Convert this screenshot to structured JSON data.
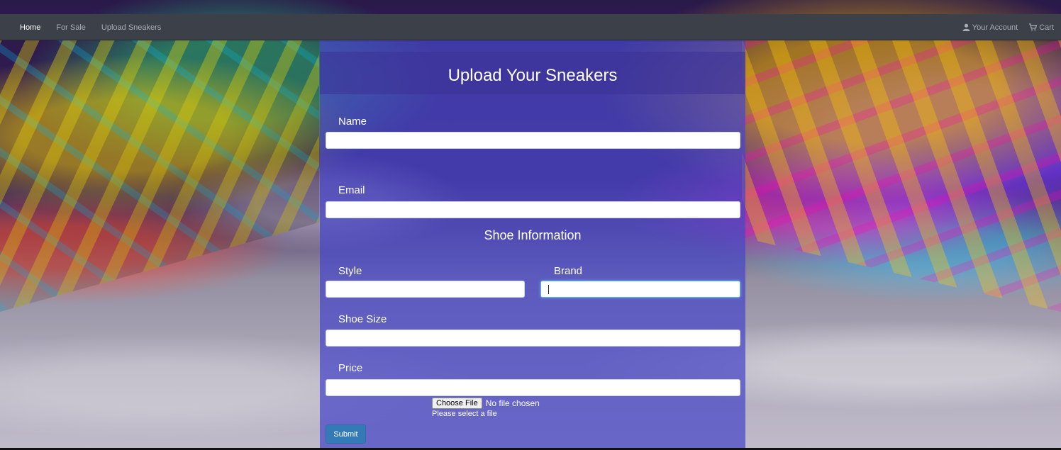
{
  "navbar": {
    "links": [
      {
        "label": "Home"
      },
      {
        "label": "For Sale"
      },
      {
        "label": "Upload Sneakers"
      }
    ],
    "account_label": "Your Account",
    "cart_label": "Cart",
    "account_icon": "user-icon",
    "cart_icon": "cart-icon"
  },
  "form": {
    "title": "Upload Your Sneakers",
    "name_label": "Name",
    "name_value": "",
    "email_label": "Email",
    "email_value": "",
    "section_title": "Shoe Information",
    "style_label": "Style",
    "style_value": "",
    "brand_label": "Brand",
    "brand_value": "",
    "size_label": "Shoe Size",
    "size_value": "",
    "price_label": "Price",
    "price_value": "",
    "file_button": "Choose File",
    "file_status": "No file chosen",
    "file_help": "Please select a file",
    "submit_label": "Submit"
  },
  "colors": {
    "navbar_bg": "#3c4048",
    "panel_bg": "#4646c8",
    "submit_bg": "#337ab7"
  }
}
